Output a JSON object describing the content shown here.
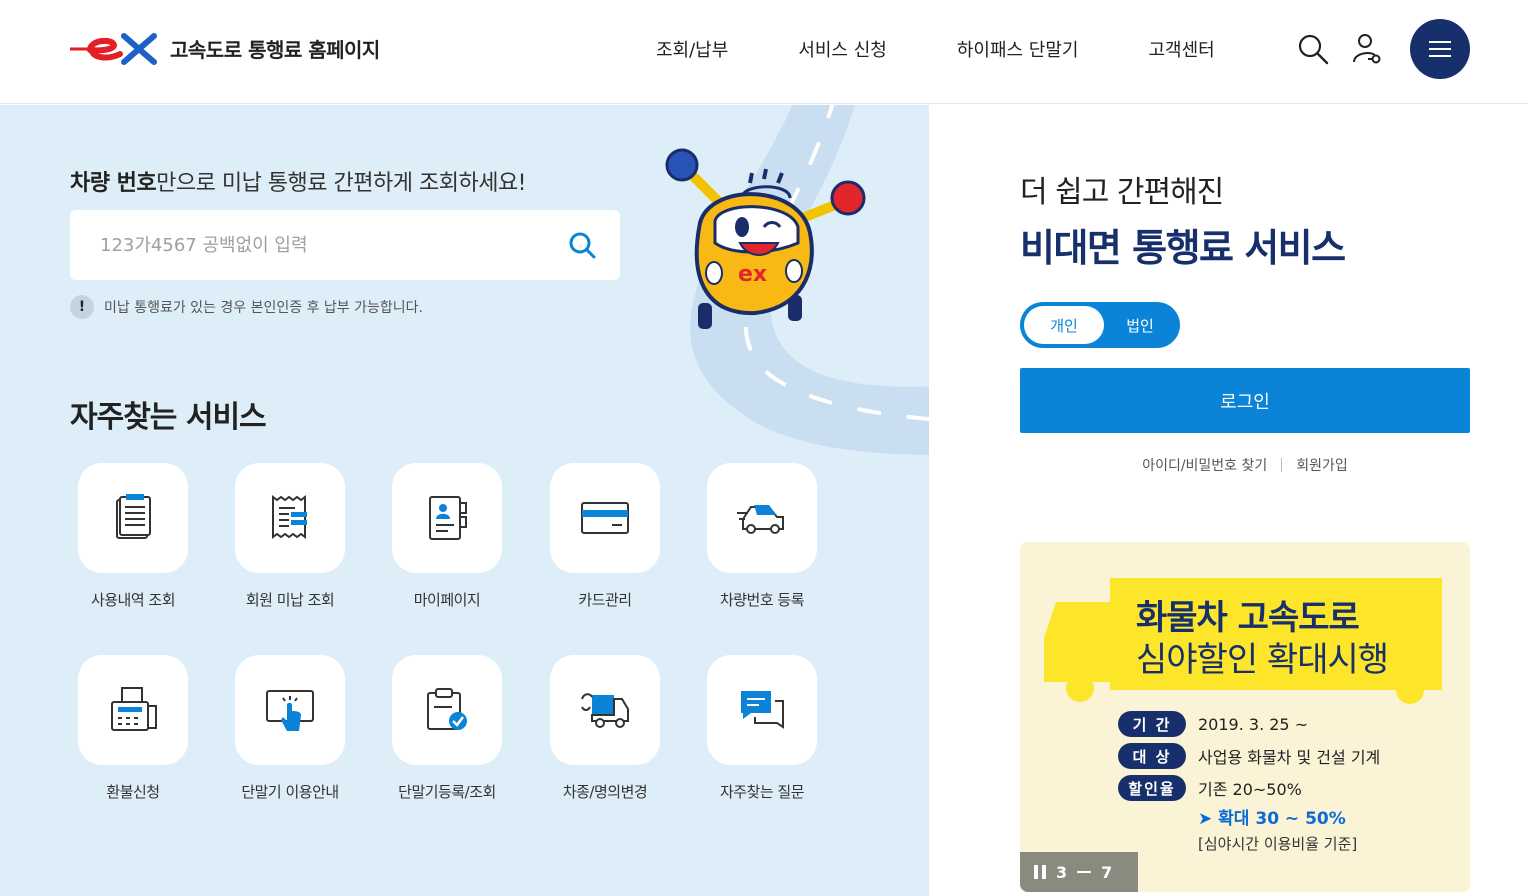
{
  "header": {
    "logo_mark": "ex",
    "logo_text": "고속도로 통행료 홈페이지",
    "nav": [
      "조회/납부",
      "서비스 신청",
      "하이패스 단말기",
      "고객센터"
    ]
  },
  "search": {
    "title_bold": "차량 번호",
    "title_rest": "만으로 미납 통행료 간편하게 조회하세요!",
    "placeholder": "123가4567 공백없이 입력",
    "notice_icon": "!",
    "notice": "미납 통행료가 있는 경우 본인인증 후 납부 가능합니다."
  },
  "services": {
    "title": "자주찾는 서비스",
    "items": [
      {
        "label": "사용내역 조회",
        "icon": "document-list-icon"
      },
      {
        "label": "회원 미납 조회",
        "icon": "receipt-icon"
      },
      {
        "label": "마이페이지",
        "icon": "profile-book-icon"
      },
      {
        "label": "카드관리",
        "icon": "credit-card-icon"
      },
      {
        "label": "차량번호 등록",
        "icon": "car-icon"
      },
      {
        "label": "환불신청",
        "icon": "fax-icon"
      },
      {
        "label": "단말기 이용안내",
        "icon": "touch-screen-icon"
      },
      {
        "label": "단말기등록/조회",
        "icon": "clipboard-check-icon"
      },
      {
        "label": "차종/명의변경",
        "icon": "truck-change-icon"
      },
      {
        "label": "자주찾는 질문",
        "icon": "chat-bubbles-icon"
      }
    ]
  },
  "login": {
    "subtitle": "더 쉽고 간편해진",
    "title": "비대면 통행료 서비스",
    "toggle_personal": "개인",
    "toggle_corporate": "법인",
    "login_button": "로그인",
    "find_link": "아이디/비밀번호 찾기",
    "join_link": "회원가입"
  },
  "banner": {
    "title_line1": "화물차 고속도로",
    "title_line2": "심야할인 확대시행",
    "rows": [
      {
        "tag": "기 간",
        "text": "2019. 3. 25 ~"
      },
      {
        "tag": "대 상",
        "text": "사업용 화물차 및 건설 기계"
      },
      {
        "tag": "할인율",
        "text": "기존 20~50%"
      }
    ],
    "extra_highlight": "➤ 확대 30 ~ 50%",
    "extra_note": "[심야시간 이용비율 기준]",
    "pager_current": "3",
    "pager_total": "7"
  },
  "colors": {
    "navy": "#17306b",
    "blue": "#0b84d8",
    "left_bg": "#ddeef8",
    "banner_bg": "#faf3d6",
    "banner_yellow": "#fde52a"
  }
}
